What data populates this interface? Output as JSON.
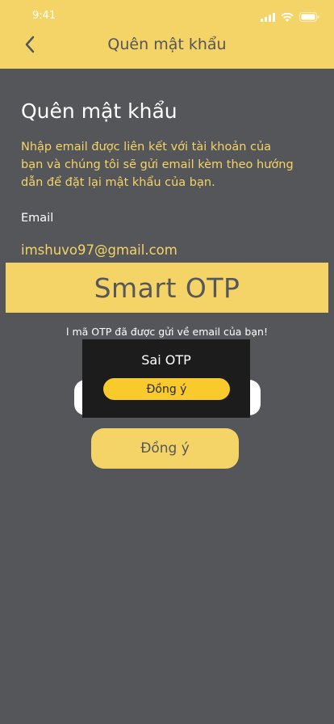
{
  "status_bar": {
    "time": "9:41",
    "icons": [
      "signal-icon",
      "wifi-icon",
      "battery-icon"
    ]
  },
  "header": {
    "back_icon": "chevron-left-icon",
    "title": "Quên mật khẩu"
  },
  "main": {
    "title": "Quên mật khẩu",
    "description": "Nhập email được liên kết với tài khoản của bạn và chúng tôi sẽ gửi email kèm theo hướng dẫn để đặt lại mật khẩu của bạn.",
    "email_label": "Email",
    "email_value": "imshuvo97@gmail.com"
  },
  "otp_banner": {
    "text": "Smart OTP"
  },
  "otp_note": "l mã OTP đã được gửi về email của bạn!",
  "alert": {
    "title": "Sai OTP",
    "button_label": "Đồng ý"
  },
  "submit_button_label": "Đồng ý",
  "colors": {
    "accent": "#f4d466",
    "background": "#55565a",
    "alert_background": "#1c1c1c",
    "alert_button": "#f8ca2c"
  }
}
